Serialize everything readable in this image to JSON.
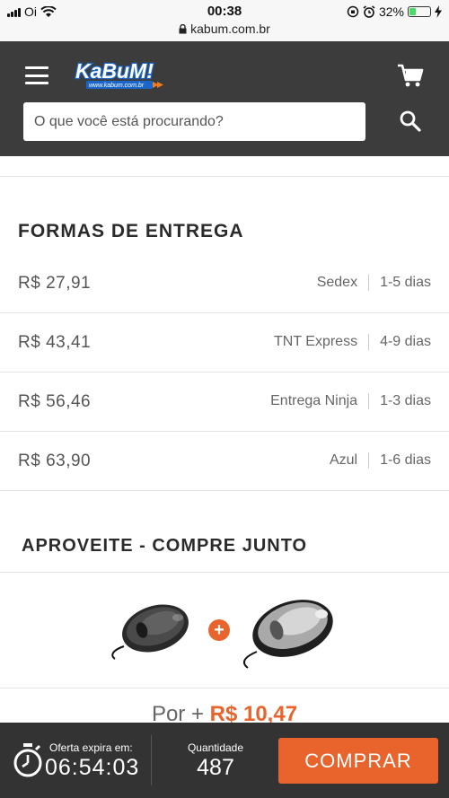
{
  "status_bar": {
    "carrier": "Oi",
    "time": "00:38",
    "url": "kabum.com.br",
    "battery": "32%"
  },
  "header": {
    "logo_text": "KaBuM!",
    "logo_subtext": "www.kabum.com.br",
    "search_placeholder": "O que você está procurando?"
  },
  "shipping": {
    "title": "FORMAS DE ENTREGA",
    "options": [
      {
        "price": "R$ 27,91",
        "carrier": "Sedex",
        "days": "1-5 dias"
      },
      {
        "price": "R$ 43,41",
        "carrier": "TNT Express",
        "days": "4-9 dias"
      },
      {
        "price": "R$ 56,46",
        "carrier": "Entrega Ninja",
        "days": "1-3 dias"
      },
      {
        "price": "R$ 63,90",
        "carrier": "Azul",
        "days": "1-6 dias"
      }
    ]
  },
  "combo": {
    "title": "APROVEITE - COMPRE JUNTO",
    "plus_symbol": "+",
    "price_prefix": "Por + ",
    "price_value": "R$ 10,47"
  },
  "bottom_bar": {
    "offer_label": "Oferta expira em:",
    "offer_time": "06:54:03",
    "quantity_label": "Quantidade",
    "quantity_value": "487",
    "buy_label": "COMPRAR"
  },
  "colors": {
    "accent": "#e8642c",
    "header_bg": "#3c3c3c",
    "bottom_bg": "#333333"
  }
}
